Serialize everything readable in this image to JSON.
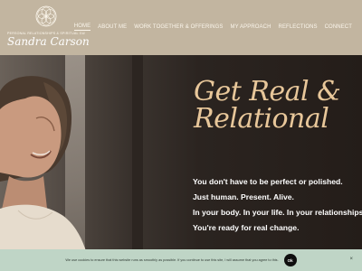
{
  "brand": {
    "tagline": "PERSONAL RELATIONSHIPS & SPIRITUAL GUIDANCE",
    "name": "Sandra Carson"
  },
  "nav": {
    "items": [
      {
        "label": "HOME",
        "active": true
      },
      {
        "label": "ABOUT ME",
        "active": false
      },
      {
        "label": "WORK TOGETHER & OFFERINGS",
        "active": false
      },
      {
        "label": "MY APPROACH",
        "active": false
      },
      {
        "label": "REFLECTIONS",
        "active": false
      },
      {
        "label": "CONNECT",
        "active": false
      }
    ]
  },
  "hero": {
    "headline_line1": "Get Real &",
    "headline_line2": "Relational",
    "lines": [
      "You don't have to be perfect or polished.",
      "Just human. Present. Alive.",
      "In your body. In your life. In your relationships.",
      "You're ready for real change."
    ]
  },
  "cookie": {
    "text": "We use cookies to ensure that this website runs as smoothly as possible. If you continue to use this site, I will assume that you agree to this.",
    "ok_label": "Ok",
    "close_label": "×"
  },
  "colors": {
    "header_bg": "#c2b5a0",
    "headline": "#e8c79a",
    "cookie_bg": "#bfd5c6"
  }
}
